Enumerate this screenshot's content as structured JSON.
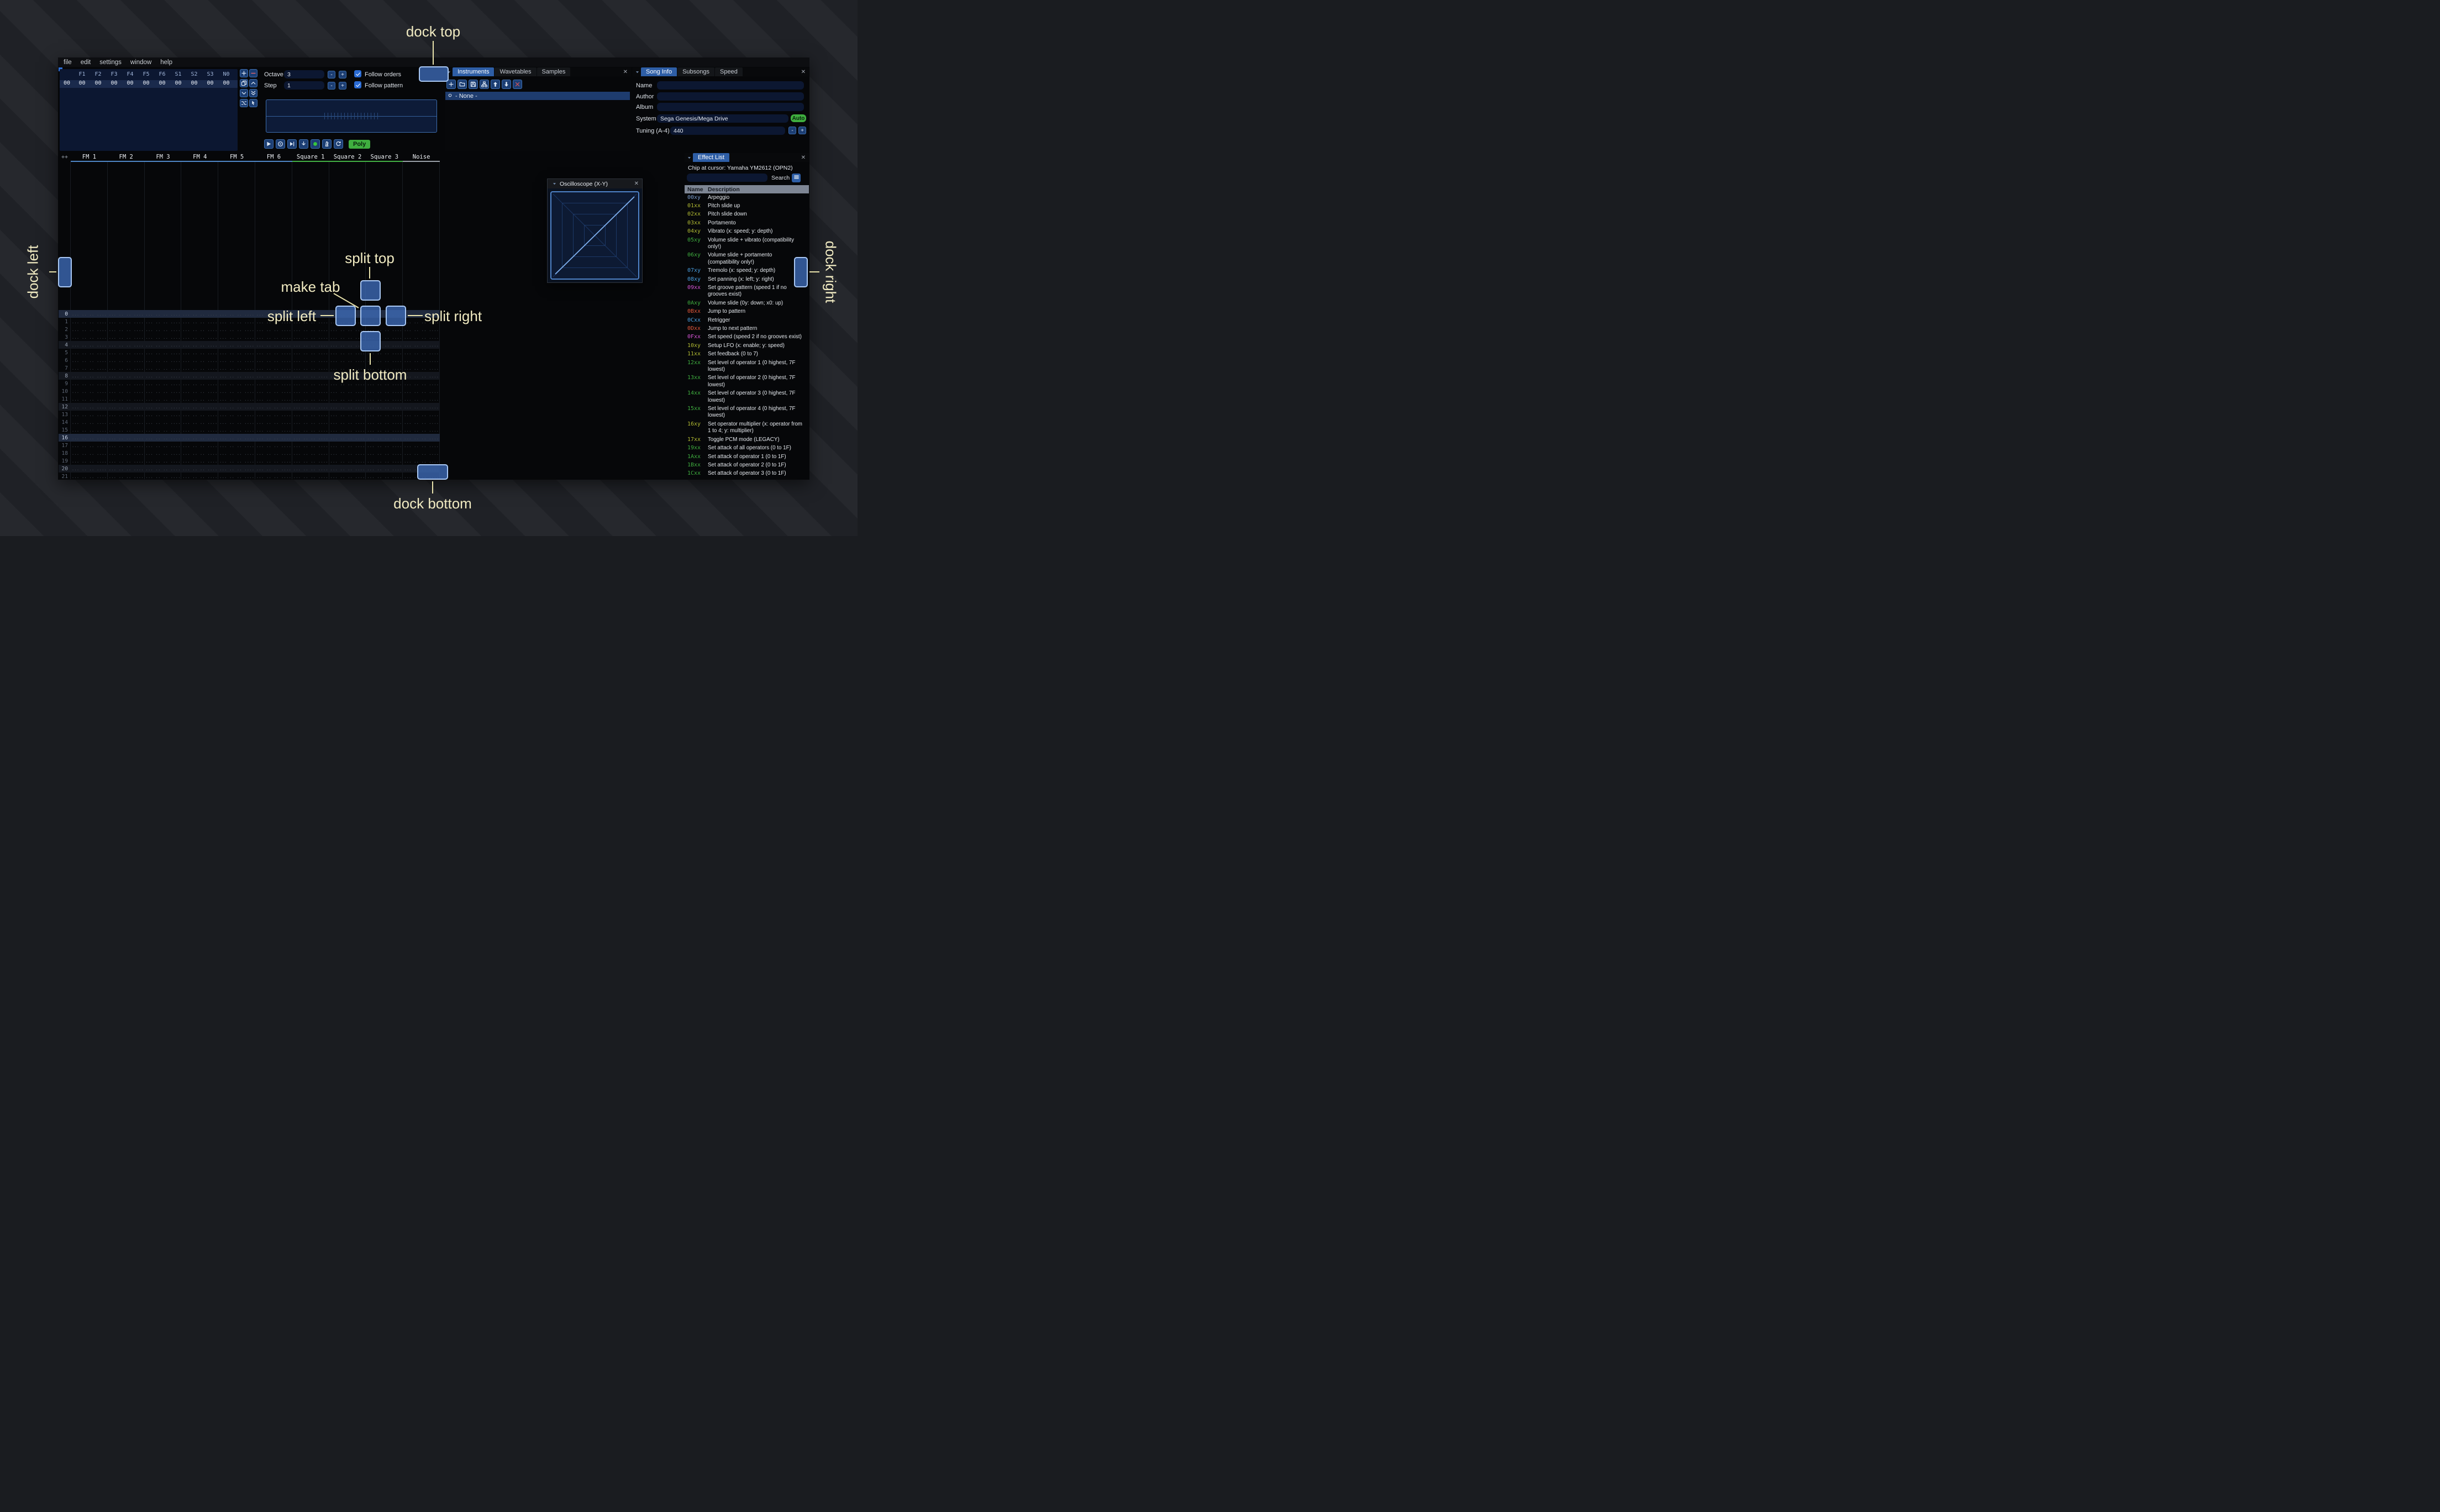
{
  "glyphs": {
    "minus": "-",
    "plus": "+",
    "close": "✕"
  },
  "labels": {
    "dock_top": "dock top",
    "dock_bottom": "dock bottom",
    "dock_left": "dock left",
    "dock_right": "dock right",
    "split_top": "split top",
    "split_bottom": "split bottom",
    "split_left": "split left",
    "split_right": "split right",
    "make_tab": "make tab"
  },
  "menu": {
    "items": [
      "file",
      "edit",
      "settings",
      "window",
      "help"
    ]
  },
  "orders": {
    "row_index": "00",
    "columns": [
      "F1",
      "F2",
      "F3",
      "F4",
      "F5",
      "F6",
      "S1",
      "S2",
      "S3",
      "N0"
    ],
    "values": [
      "00",
      "00",
      "00",
      "00",
      "00",
      "00",
      "00",
      "00",
      "00",
      "00"
    ],
    "buttons": [
      {
        "name": "add-order",
        "icon": "plus"
      },
      {
        "name": "remove-order",
        "icon": "minus",
        "color": "#ff6b6b"
      },
      {
        "name": "duplicate-order",
        "icon": "copy"
      },
      {
        "name": "move-order-up",
        "icon": "chevron-up"
      },
      {
        "name": "move-order-down",
        "icon": "chevron-down"
      },
      {
        "name": "duplicate-order-to-end",
        "icon": "double-down"
      },
      {
        "name": "order-change-mode",
        "icon": "exchange"
      },
      {
        "name": "order-edit-mode",
        "icon": "pointer"
      }
    ]
  },
  "play_controls": {
    "octave_label": "Octave",
    "octave_value": "3",
    "step_label": "Step",
    "step_value": "1",
    "follow_orders_label": "Follow orders",
    "follow_pattern_label": "Follow pattern",
    "poly_label": "Poly",
    "buttons": [
      {
        "name": "play",
        "icon": "play"
      },
      {
        "name": "play-from-beginning",
        "icon": "circle-play"
      },
      {
        "name": "play-once",
        "icon": "skip"
      },
      {
        "name": "step-one-row",
        "icon": "arrow-down"
      },
      {
        "name": "edit-toggle",
        "icon": "record",
        "color": "#38c53e"
      },
      {
        "name": "metronome",
        "icon": "metronome"
      },
      {
        "name": "repeat-pattern",
        "icon": "repeat"
      }
    ]
  },
  "instruments": {
    "tabs": [
      {
        "label": "Instruments",
        "active": true
      },
      {
        "label": "Wavetables",
        "active": false
      },
      {
        "label": "Samples",
        "active": false
      }
    ],
    "toolbar": [
      {
        "name": "add-instrument",
        "icon": "plus"
      },
      {
        "name": "open-instrument",
        "icon": "folder"
      },
      {
        "name": "save-instrument",
        "icon": "floppy"
      },
      {
        "name": "instrument-folders",
        "icon": "sitemap"
      },
      {
        "name": "move-instrument-up",
        "icon": "arrow-up"
      },
      {
        "name": "move-instrument-down",
        "icon": "arrow-down-f"
      },
      {
        "name": "delete-instrument",
        "icon": "x",
        "color": "#e05252"
      }
    ],
    "list": [
      {
        "label": "- None -",
        "selected": true
      }
    ]
  },
  "song_info": {
    "tabs": [
      {
        "label": "Song Info",
        "active": true
      },
      {
        "label": "Subsongs",
        "active": false
      },
      {
        "label": "Speed",
        "active": false
      }
    ],
    "fields": {
      "name_label": "Name",
      "name_value": "",
      "author_label": "Author",
      "author_value": "",
      "album_label": "Album",
      "album_value": "",
      "system_label": "System",
      "system_value": "Sega Genesis/Mega Drive",
      "auto_label": "Auto",
      "tuning_label": "Tuning (A-4)",
      "tuning_value": "440"
    }
  },
  "pattern": {
    "expand_label": "++",
    "empty_cell": "... .. .. ....",
    "channels": [
      {
        "name": "FM 1",
        "color": "#4f86c6"
      },
      {
        "name": "FM 2",
        "color": "#4f86c6"
      },
      {
        "name": "FM 3",
        "color": "#4f86c6"
      },
      {
        "name": "FM 4",
        "color": "#4f86c6"
      },
      {
        "name": "FM 5",
        "color": "#4f86c6"
      },
      {
        "name": "FM 6",
        "color": "#4f86c6"
      },
      {
        "name": "Square 1",
        "color": "#43b043"
      },
      {
        "name": "Square 2",
        "color": "#43b043"
      },
      {
        "name": "Square 3",
        "color": "#43b043"
      },
      {
        "name": "Noise",
        "color": "#9aa0a8"
      }
    ],
    "row_numbers": [
      "0",
      "1",
      "2",
      "3",
      "4",
      "5",
      "6",
      "7",
      "8",
      "9",
      "10",
      "11",
      "12",
      "13",
      "14",
      "15",
      "16",
      "17",
      "18",
      "19",
      "20",
      "21"
    ]
  },
  "oscilloscope": {
    "title": "Oscilloscope (X-Y)"
  },
  "effect_list": {
    "tab_label": "Effect List",
    "chip_line": "Chip at cursor: Yamaha YM2612 (OPN2)",
    "search_label": "Search",
    "search_value": "",
    "header": {
      "name": "Name",
      "description": "Description"
    },
    "colors": {
      "slate": "#7d9fce",
      "olive": "#b2bb33",
      "green": "#3fae3f",
      "blue": "#4a9fe0",
      "magenta": "#d455d4",
      "red": "#e0563a"
    },
    "effects": [
      {
        "code": "00xy",
        "desc": "Arpeggio",
        "color": "slate"
      },
      {
        "code": "01xx",
        "desc": "Pitch slide up",
        "color": "olive"
      },
      {
        "code": "02xx",
        "desc": "Pitch slide down",
        "color": "olive"
      },
      {
        "code": "03xx",
        "desc": "Portamento",
        "color": "olive"
      },
      {
        "code": "04xy",
        "desc": "Vibrato (x: speed; y: depth)",
        "color": "olive"
      },
      {
        "code": "05xy",
        "desc": "Volume slide + vibrato (compatibility only!)",
        "color": "green"
      },
      {
        "code": "06xy",
        "desc": "Volume slide + portamento (compatibility only!)",
        "color": "green"
      },
      {
        "code": "07xy",
        "desc": "Tremolo (x: speed; y: depth)",
        "color": "blue"
      },
      {
        "code": "08xy",
        "desc": "Set panning (x: left; y: right)",
        "color": "blue"
      },
      {
        "code": "09xx",
        "desc": "Set groove pattern (speed 1 if no grooves exist)",
        "color": "magenta"
      },
      {
        "code": "0Axy",
        "desc": "Volume slide (0y: down; x0: up)",
        "color": "green"
      },
      {
        "code": "0Bxx",
        "desc": "Jump to pattern",
        "color": "red"
      },
      {
        "code": "0Cxx",
        "desc": "Retrigger",
        "color": "blue"
      },
      {
        "code": "0Dxx",
        "desc": "Jump to next pattern",
        "color": "red"
      },
      {
        "code": "0Fxx",
        "desc": "Set speed (speed 2 if no grooves exist)",
        "color": "magenta"
      },
      {
        "code": "10xy",
        "desc": "Setup LFO (x: enable; y: speed)",
        "color": "olive"
      },
      {
        "code": "11xx",
        "desc": "Set feedback (0 to 7)",
        "color": "olive"
      },
      {
        "code": "12xx",
        "desc": "Set level of operator 1 (0 highest, 7F lowest)",
        "color": "green"
      },
      {
        "code": "13xx",
        "desc": "Set level of operator 2 (0 highest, 7F lowest)",
        "color": "green"
      },
      {
        "code": "14xx",
        "desc": "Set level of operator 3 (0 highest, 7F lowest)",
        "color": "green"
      },
      {
        "code": "15xx",
        "desc": "Set level of operator 4 (0 highest, 7F lowest)",
        "color": "green"
      },
      {
        "code": "16xy",
        "desc": "Set operator multiplier (x: operator from 1 to 4; y: multiplier)",
        "color": "olive"
      },
      {
        "code": "17xx",
        "desc": "Toggle PCM mode (LEGACY)",
        "color": "olive"
      },
      {
        "code": "19xx",
        "desc": "Set attack of all operators (0 to 1F)",
        "color": "green"
      },
      {
        "code": "1Axx",
        "desc": "Set attack of operator 1 (0 to 1F)",
        "color": "green"
      },
      {
        "code": "1Bxx",
        "desc": "Set attack of operator 2 (0 to 1F)",
        "color": "green"
      },
      {
        "code": "1Cxx",
        "desc": "Set attack of operator 3 (0 to 1F)",
        "color": "green"
      }
    ]
  }
}
